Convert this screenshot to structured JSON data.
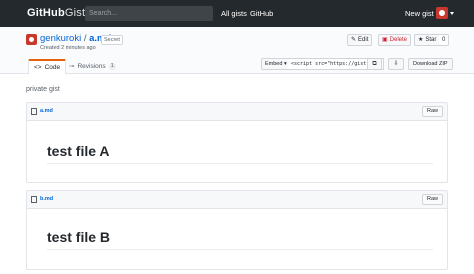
{
  "nav": {
    "logo_bold": "GitHub",
    "logo_light": "Gist",
    "search_placeholder": "Search...",
    "all_gists": "All gists",
    "github": "GitHub",
    "new_gist": "New gist"
  },
  "gist": {
    "owner": "genkuroki",
    "separator": "/",
    "file": "a.md",
    "secret_badge": "Secret",
    "created": "Created 2 minutes ago"
  },
  "actions": {
    "edit": "Edit",
    "delete": "Delete",
    "star": "Star",
    "star_count": "0"
  },
  "tabs": {
    "code": "Code",
    "revisions": "Revisions",
    "revisions_count": "1"
  },
  "embed": {
    "select_label": "Embed",
    "snippet": "<script src=\"https://gist.",
    "download_zip": "Download ZIP"
  },
  "description": "private gist",
  "files": [
    {
      "name": "a.md",
      "raw": "Raw",
      "heading": "test file A"
    },
    {
      "name": "b.md",
      "raw": "Raw",
      "heading": "test file B"
    }
  ],
  "colors": {
    "nav_bg": "#24292e",
    "link": "#0366d6",
    "tab_accent": "#e36209",
    "delete": "#cb2431",
    "avatar": "#c8382c"
  }
}
